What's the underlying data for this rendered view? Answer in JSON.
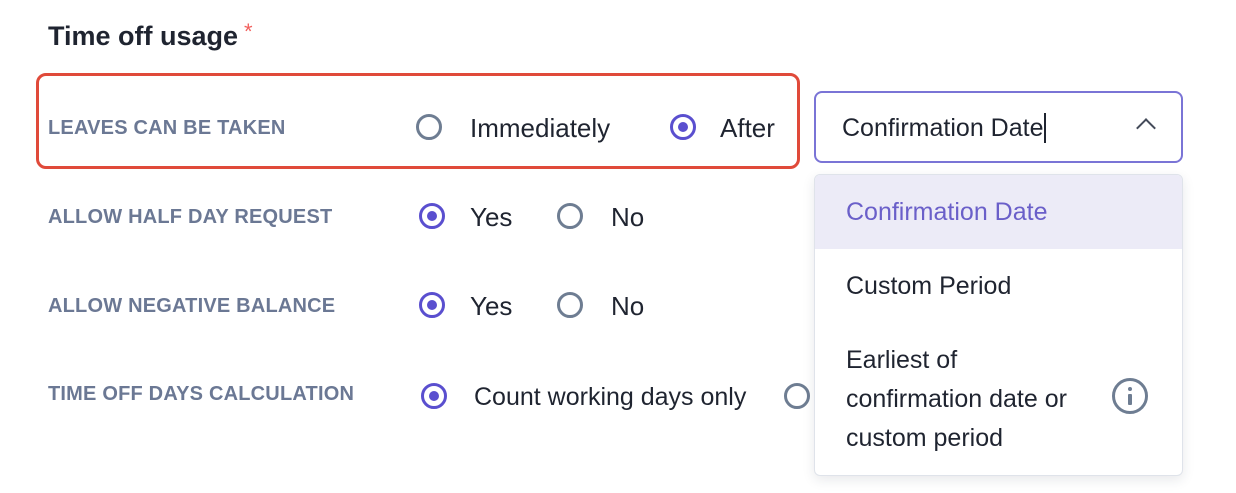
{
  "section": {
    "title": "Time off usage",
    "required_mark": "*"
  },
  "rows": [
    {
      "label": "LEAVES CAN BE TAKEN",
      "options": [
        {
          "label": "Immediately",
          "checked": false
        },
        {
          "label": "After",
          "checked": true
        }
      ]
    },
    {
      "label": "ALLOW HALF DAY REQUEST",
      "options": [
        {
          "label": "Yes",
          "checked": true
        },
        {
          "label": "No",
          "checked": false
        }
      ]
    },
    {
      "label": "ALLOW NEGATIVE BALANCE",
      "options": [
        {
          "label": "Yes",
          "checked": true
        },
        {
          "label": "No",
          "checked": false
        }
      ]
    },
    {
      "label": "TIME OFF DAYS CALCULATION",
      "options": [
        {
          "label": "Count working days only",
          "checked": true
        },
        {
          "label": "",
          "checked": false
        }
      ]
    }
  ],
  "after_select": {
    "value": "Confirmation Date",
    "icon": "chevron-up-icon",
    "options": [
      {
        "label": "Confirmation Date",
        "selected": true
      },
      {
        "label": "Custom Period",
        "selected": false
      },
      {
        "label": "Earliest of",
        "line2": "confirmation date or",
        "line3": "custom period",
        "selected": false,
        "icon": "info-icon"
      }
    ]
  },
  "colors": {
    "accent": "#5a4fcf",
    "highlight_border": "#e04a3a",
    "label_text": "#6b7894",
    "selected_option_bg": "#ecebf7"
  }
}
